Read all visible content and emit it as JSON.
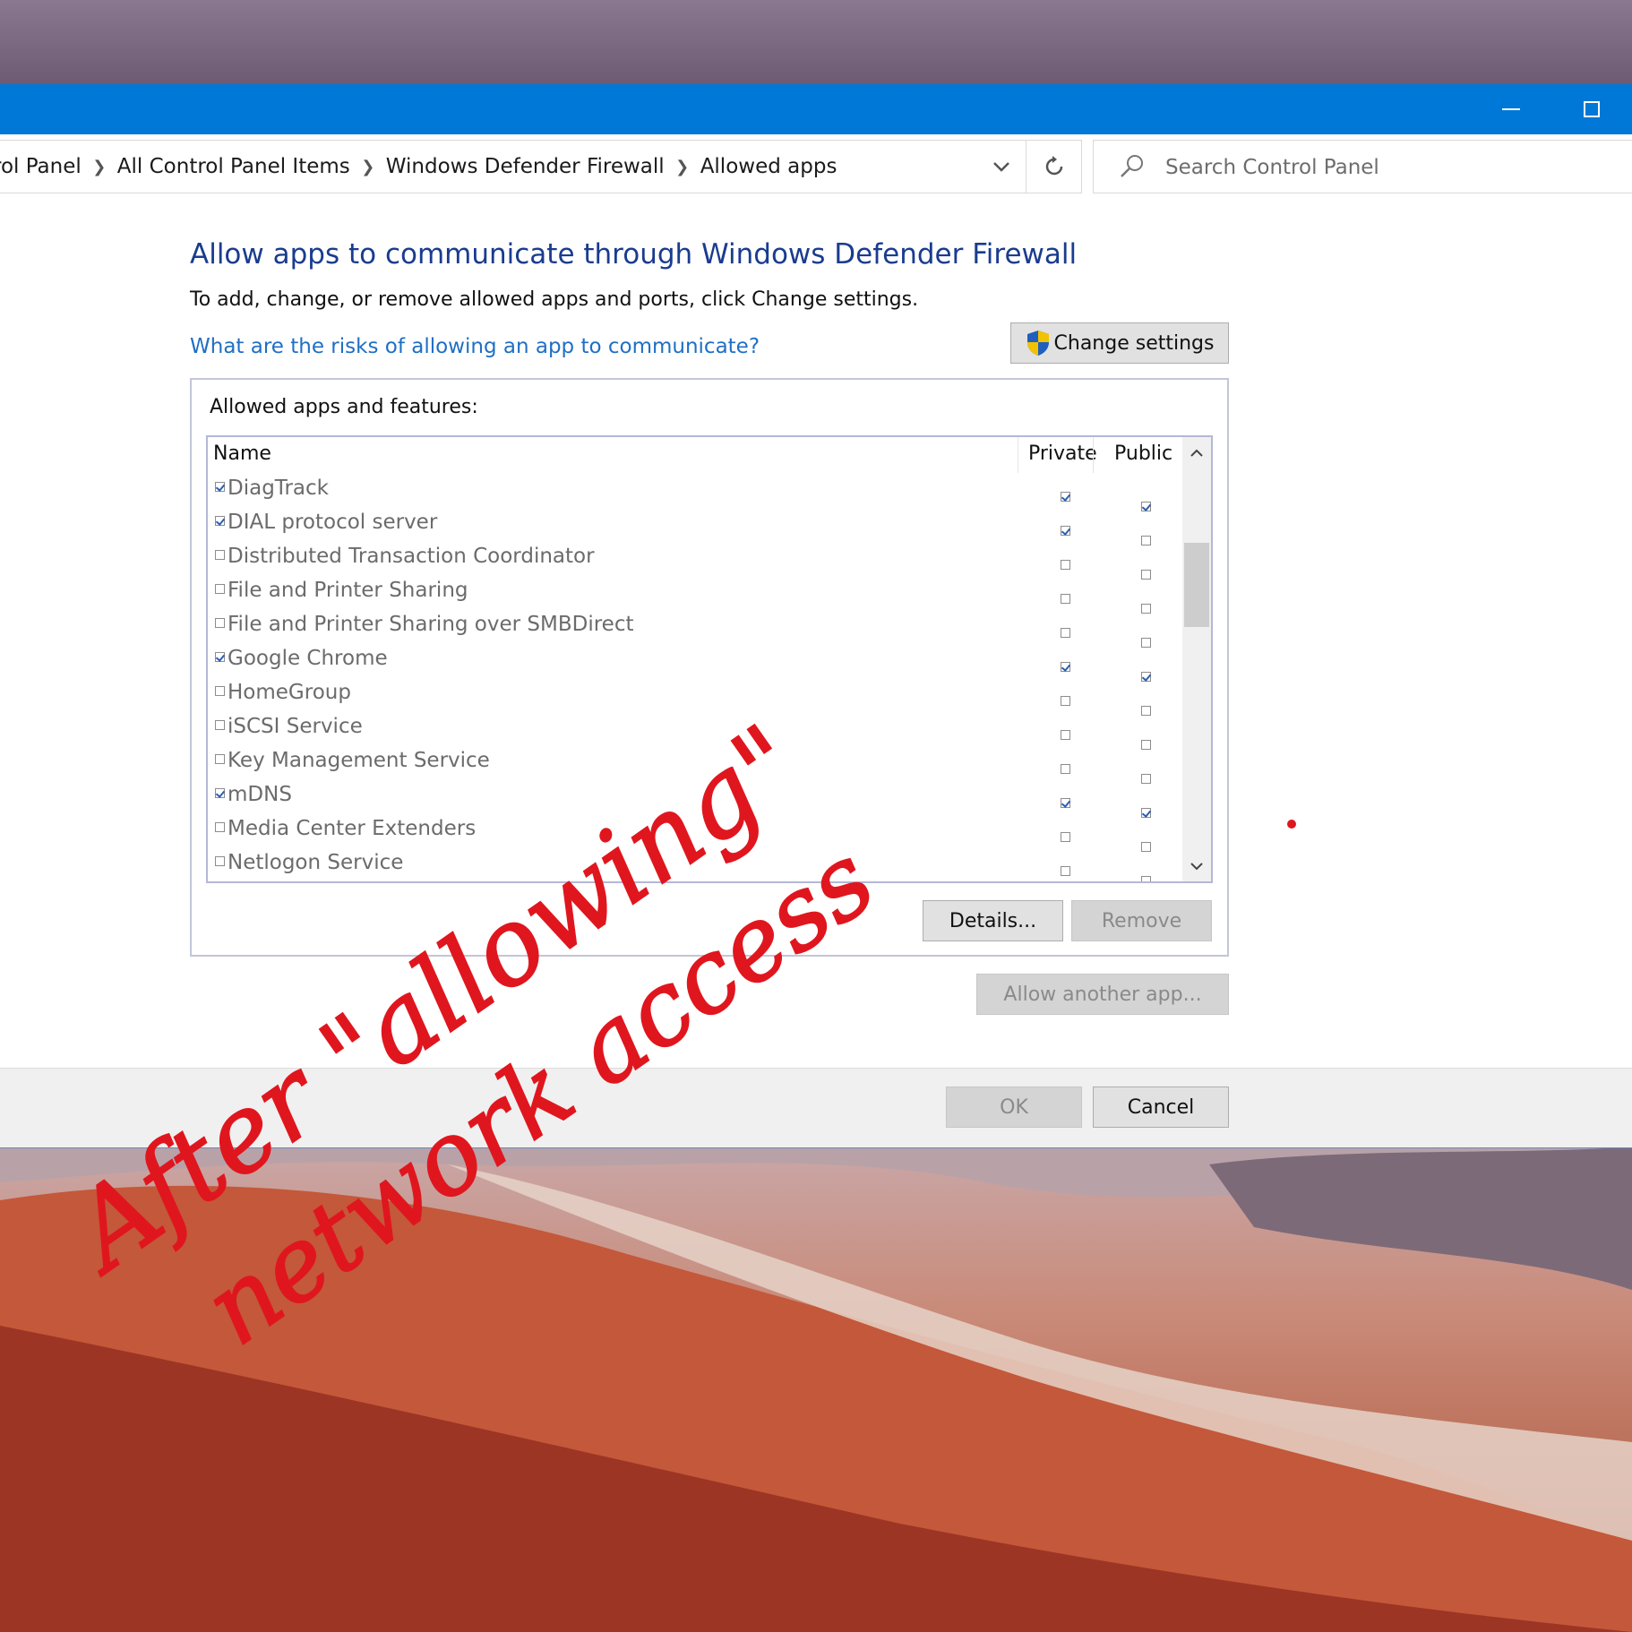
{
  "window": {
    "titlebar": {
      "minimize_icon": "minimize-icon",
      "maximize_icon": "maximize-icon"
    }
  },
  "address": {
    "crumbs": [
      "rol Panel",
      "All Control Panel Items",
      "Windows Defender Firewall",
      "Allowed apps"
    ],
    "search_placeholder": "Search Control Panel"
  },
  "main": {
    "heading": "Allow apps to communicate through Windows Defender Firewall",
    "subtext": "To add, change, or remove allowed apps and ports, click Change settings.",
    "risk_link": "What are the risks of allowing an app to communicate?",
    "change_settings": "Change settings",
    "group_label": "Allowed apps and features:",
    "columns": {
      "name": "Name",
      "private": "Private",
      "public": "Public"
    },
    "apps": [
      {
        "name": "DiagTrack",
        "enabled": true,
        "private": true,
        "public": true
      },
      {
        "name": "DIAL protocol server",
        "enabled": true,
        "private": true,
        "public": false
      },
      {
        "name": "Distributed Transaction Coordinator",
        "enabled": false,
        "private": false,
        "public": false
      },
      {
        "name": "File and Printer Sharing",
        "enabled": false,
        "private": false,
        "public": false
      },
      {
        "name": "File and Printer Sharing over SMBDirect",
        "enabled": false,
        "private": false,
        "public": false
      },
      {
        "name": "Google Chrome",
        "enabled": true,
        "private": true,
        "public": true
      },
      {
        "name": "HomeGroup",
        "enabled": false,
        "private": false,
        "public": false
      },
      {
        "name": "iSCSI Service",
        "enabled": false,
        "private": false,
        "public": false
      },
      {
        "name": "Key Management Service",
        "enabled": false,
        "private": false,
        "public": false
      },
      {
        "name": "mDNS",
        "enabled": true,
        "private": true,
        "public": true
      },
      {
        "name": "Media Center Extenders",
        "enabled": false,
        "private": false,
        "public": false
      },
      {
        "name": "Netlogon Service",
        "enabled": false,
        "private": false,
        "public": false
      }
    ],
    "details": "Details...",
    "remove": "Remove",
    "allow_another": "Allow another app..."
  },
  "footer": {
    "ok": "OK",
    "cancel": "Cancel"
  },
  "annotation": {
    "line1": "After \"allowing\"",
    "line2": "network access",
    "color": "#e0161e"
  },
  "colors": {
    "titlebar": "#0078d7",
    "heading": "#1a3c8f",
    "link": "#1f6fc5"
  }
}
